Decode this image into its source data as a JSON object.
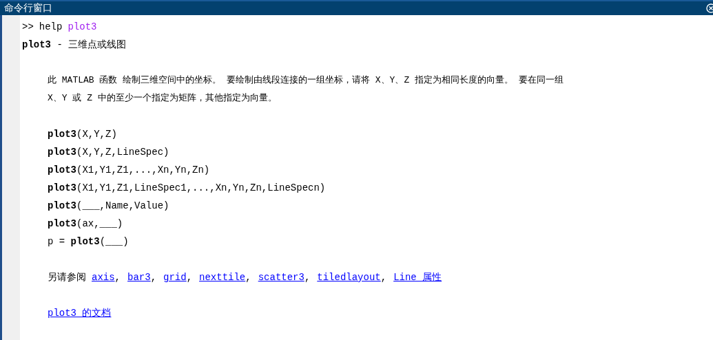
{
  "window": {
    "title": "命令行窗口"
  },
  "prompt": {
    "symbol": ">>",
    "command": "help",
    "argument": "plot3"
  },
  "heading": "**plot3** - 三维点或线图",
  "description": [
    "此 MATLAB 函数 绘制三维空间中的坐标。 要绘制由线段连接的一组坐标，请将 X、Y、Z 指定为相同长度的向量。 要在同一组",
    "X、Y 或 Z 中的至少一个指定为矩阵，其他指定为向量。"
  ],
  "syntax": [
    "**plot3**(X,Y,Z)",
    "**plot3**(X,Y,Z,LineSpec)",
    "**plot3**(X1,Y1,Z1,...,Xn,Yn,Zn)",
    "**plot3**(X1,Y1,Z1,LineSpec1,...,Xn,Yn,Zn,LineSpecn)",
    "**plot3**(___,Name,Value)",
    "**plot3**(ax,___)",
    "p = **plot3**(___)"
  ],
  "see_also": {
    "label": "另请参阅",
    "separator": ",",
    "links": [
      "axis",
      "bar3",
      "grid",
      "nexttile",
      "scatter3",
      "tiledlayout",
      "Line 属性"
    ]
  },
  "doc_link": "plot3 的文档"
}
